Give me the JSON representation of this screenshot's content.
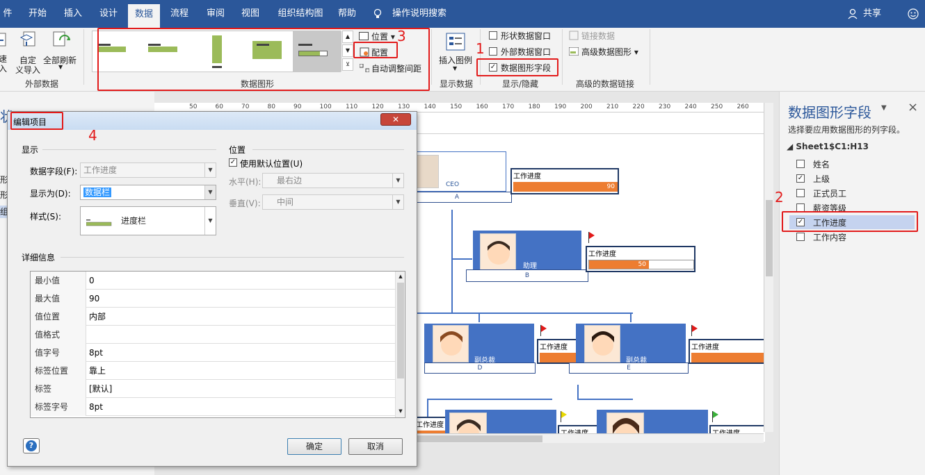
{
  "menu_tabs": [
    "件",
    "开始",
    "插入",
    "设计",
    "数据",
    "流程",
    "审阅",
    "视图",
    "组织结构图",
    "帮助"
  ],
  "menu_search": "操作说明搜索",
  "menu_share": "共享",
  "ribbon": {
    "ext_quick": "速\n入",
    "ext_custom_l1": "自定",
    "ext_custom_l2": "义导入",
    "ext_refresh_l1": "全部刷新",
    "ext_refresh_l2": "",
    "group_external": "外部数据",
    "position_label": "位置",
    "config_label": "配置",
    "auto_spacing_label": "自动调整间距",
    "group_data_graphics": "数据图形",
    "insert_legend_l1": "插入图例",
    "group_show_data": "显示数据",
    "shape_data_window": "形状数据窗口",
    "external_data_window": "外部数据窗口",
    "data_graphic_fields": "数据图形字段",
    "group_show_hide": "显示/隐藏",
    "link_data": "链接数据",
    "advanced_data_graphics": "高级数据图形",
    "group_advanced_link": "高级的数据链接",
    "marker_1": "1",
    "marker_3": "3"
  },
  "ruler_ticks": [
    "50",
    "60",
    "70",
    "80",
    "90",
    "100",
    "110",
    "120",
    "130",
    "140",
    "150",
    "160",
    "170",
    "180",
    "190",
    "200",
    "210",
    "220",
    "230",
    "240",
    "250",
    "260"
  ],
  "canvas": {
    "ceo_title": "CEO",
    "ceo_base": "A",
    "assistant_title": "助理",
    "assistant_base": "B",
    "vp1_title": "副总裁",
    "vp1_base": "D",
    "vp2_title": "副总裁",
    "vp2_base": "E",
    "progress_label": "工作进度",
    "ceo_value": "90",
    "assistant_value": "50"
  },
  "pane": {
    "title": "数据图形字段",
    "subtitle": "选择要应用数据图形的列字段。",
    "tree_root": "Sheet1$C1:H13",
    "fields": [
      {
        "label": "姓名",
        "checked": false
      },
      {
        "label": "上级",
        "checked": true
      },
      {
        "label": "正式员工",
        "checked": false
      },
      {
        "label": "薪资等级",
        "checked": false
      },
      {
        "label": "工作进度",
        "checked": true
      },
      {
        "label": "工作内容",
        "checked": false
      }
    ],
    "marker_2": "2",
    "close": "×",
    "dropdown": "▼"
  },
  "dialog": {
    "title": "编辑项目",
    "marker_4": "4",
    "section_display": "显示",
    "data_field_label": "数据字段(F):",
    "data_field_value": "工作进度",
    "show_as_label": "显示为(D):",
    "show_as_value": "数据栏",
    "style_label": "样式(S):",
    "style_value": "进度栏",
    "section_position": "位置",
    "use_default_position": "使用默认位置(U)",
    "horizontal_label": "水平(H):",
    "horizontal_value": "最右边",
    "vertical_label": "垂直(V):",
    "vertical_value": "中间",
    "section_details": "详细信息",
    "details": [
      {
        "key": "最小值",
        "value": "0"
      },
      {
        "key": "最大值",
        "value": "90"
      },
      {
        "key": "值位置",
        "value": "内部"
      },
      {
        "key": "值格式",
        "value": ""
      },
      {
        "key": "值字号",
        "value": "8pt"
      },
      {
        "key": "标签位置",
        "value": "靠上"
      },
      {
        "key": "标签",
        "value": "[默认]"
      },
      {
        "key": "标签字号",
        "value": "8pt"
      }
    ],
    "ok": "确定",
    "cancel": "取消",
    "help": "?"
  },
  "left_partial": [
    "状",
    "形",
    "形",
    "组"
  ],
  "colors": {
    "accent": "#2b579a",
    "bar": "#ed7d31",
    "node": "#4472c4",
    "highlight": "#e21a1a"
  }
}
